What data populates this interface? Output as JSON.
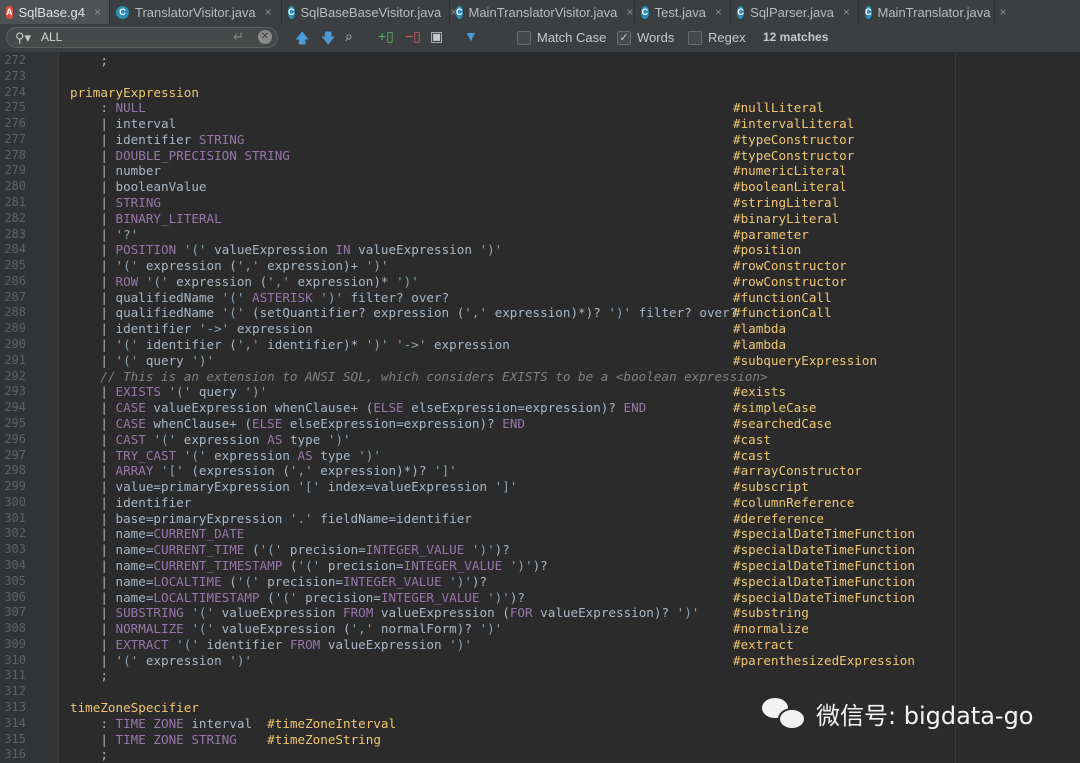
{
  "tabs": [
    {
      "label": "SqlBase.g4",
      "icon": "antlr-file-icon",
      "active": true
    },
    {
      "label": "TranslatorVisitor.java",
      "icon": "java-class-icon",
      "active": false
    },
    {
      "label": "SqlBaseBaseVisitor.java",
      "icon": "java-class-icon",
      "active": false
    },
    {
      "label": "MainTranslatorVisitor.java",
      "icon": "java-class-icon",
      "active": false
    },
    {
      "label": "Test.java",
      "icon": "java-class-icon",
      "active": false
    },
    {
      "label": "SqlParser.java",
      "icon": "java-class-icon",
      "active": false
    },
    {
      "label": "MainTranslator.java",
      "icon": "java-class-icon",
      "active": false
    }
  ],
  "search": {
    "value": "ALL",
    "match_case_label": "Match Case",
    "match_case": false,
    "words_label": "Words",
    "words": true,
    "regex_label": "Regex",
    "regex": false,
    "matches": "12 matches"
  },
  "editor": {
    "lines": [
      {
        "n": "272",
        "code": [
          [
            "    ;",
            "op"
          ]
        ],
        "label": ""
      },
      {
        "n": "273",
        "code": [],
        "label": ""
      },
      {
        "n": "274",
        "code": [
          [
            "primaryExpression",
            "rule"
          ]
        ],
        "label": ""
      },
      {
        "n": "275",
        "code": [
          [
            "    : ",
            "op"
          ],
          [
            "NULL",
            "kw"
          ]
        ],
        "label": "#nullLiteral"
      },
      {
        "n": "276",
        "code": [
          [
            "    | interval",
            "op"
          ]
        ],
        "label": "#intervalLiteral"
      },
      {
        "n": "277",
        "code": [
          [
            "    | identifier ",
            "op"
          ],
          [
            "STRING",
            "kw"
          ]
        ],
        "label": "#typeConstructor"
      },
      {
        "n": "278",
        "code": [
          [
            "    | ",
            "op"
          ],
          [
            "DOUBLE_PRECISION STRING",
            "kw"
          ]
        ],
        "label": "#typeConstructor"
      },
      {
        "n": "279",
        "code": [
          [
            "    | number",
            "op"
          ]
        ],
        "label": "#numericLiteral"
      },
      {
        "n": "280",
        "code": [
          [
            "    | booleanValue",
            "op"
          ]
        ],
        "label": "#booleanLiteral"
      },
      {
        "n": "281",
        "code": [
          [
            "    | ",
            "op"
          ],
          [
            "STRING",
            "kw"
          ]
        ],
        "label": "#stringLiteral"
      },
      {
        "n": "282",
        "code": [
          [
            "    | ",
            "op"
          ],
          [
            "BINARY_LITERAL",
            "kw"
          ]
        ],
        "label": "#binaryLiteral"
      },
      {
        "n": "283",
        "code": [
          [
            "    | ",
            "op"
          ],
          [
            "'?'",
            "str"
          ]
        ],
        "label": "#parameter"
      },
      {
        "n": "284",
        "code": [
          [
            "    | ",
            "op"
          ],
          [
            "POSITION",
            "kw"
          ],
          [
            " ",
            "op"
          ],
          [
            "'('",
            "str"
          ],
          [
            " valueExpression ",
            "op"
          ],
          [
            "IN",
            "kw"
          ],
          [
            " valueExpression ",
            "op"
          ],
          [
            "')'",
            "str"
          ]
        ],
        "label": "#position"
      },
      {
        "n": "285",
        "code": [
          [
            "    | ",
            "op"
          ],
          [
            "'('",
            "str"
          ],
          [
            " expression (",
            "op"
          ],
          [
            "','",
            "str"
          ],
          [
            " expression)+ ",
            "op"
          ],
          [
            "')'",
            "str"
          ]
        ],
        "label": "#rowConstructor"
      },
      {
        "n": "286",
        "code": [
          [
            "    | ",
            "op"
          ],
          [
            "ROW",
            "kw"
          ],
          [
            " ",
            "op"
          ],
          [
            "'('",
            "str"
          ],
          [
            " expression (",
            "op"
          ],
          [
            "','",
            "str"
          ],
          [
            " expression)* ",
            "op"
          ],
          [
            "')'",
            "str"
          ]
        ],
        "label": "#rowConstructor"
      },
      {
        "n": "287",
        "code": [
          [
            "    | qualifiedName ",
            "op"
          ],
          [
            "'('",
            "str"
          ],
          [
            " ",
            "op"
          ],
          [
            "ASTERISK",
            "kw"
          ],
          [
            " ",
            "op"
          ],
          [
            "')'",
            "str"
          ],
          [
            " filter? over?",
            "op"
          ]
        ],
        "label": "#functionCall"
      },
      {
        "n": "288",
        "code": [
          [
            "    | qualifiedName ",
            "op"
          ],
          [
            "'('",
            "str"
          ],
          [
            " (setQuantifier? expression (",
            "op"
          ],
          [
            "','",
            "str"
          ],
          [
            " expression)*)? ",
            "op"
          ],
          [
            "')'",
            "str"
          ],
          [
            " filter? over?",
            "op"
          ]
        ],
        "label": "#functionCall"
      },
      {
        "n": "289",
        "code": [
          [
            "    | identifier ",
            "op"
          ],
          [
            "'->'",
            "str"
          ],
          [
            " expression",
            "op"
          ]
        ],
        "label": "#lambda"
      },
      {
        "n": "290",
        "code": [
          [
            "    | ",
            "op"
          ],
          [
            "'('",
            "str"
          ],
          [
            " identifier (",
            "op"
          ],
          [
            "','",
            "str"
          ],
          [
            " identifier)* ",
            "op"
          ],
          [
            "')'",
            "str"
          ],
          [
            " ",
            "op"
          ],
          [
            "'->'",
            "str"
          ],
          [
            " expression",
            "op"
          ]
        ],
        "label": "#lambda"
      },
      {
        "n": "291",
        "code": [
          [
            "    | ",
            "op"
          ],
          [
            "'('",
            "str"
          ],
          [
            " query ",
            "op"
          ],
          [
            "')'",
            "str"
          ]
        ],
        "label": "#subqueryExpression"
      },
      {
        "n": "292",
        "code": [
          [
            "    // This is an extension to ANSI SQL, which considers EXISTS to be a <boolean expression>",
            "cmt"
          ]
        ],
        "label": ""
      },
      {
        "n": "293",
        "code": [
          [
            "    | ",
            "op"
          ],
          [
            "EXISTS",
            "kw"
          ],
          [
            " ",
            "op"
          ],
          [
            "'('",
            "str"
          ],
          [
            " query ",
            "op"
          ],
          [
            "')'",
            "str"
          ]
        ],
        "label": "#exists"
      },
      {
        "n": "294",
        "code": [
          [
            "    | ",
            "op"
          ],
          [
            "CASE",
            "kw"
          ],
          [
            " valueExpression whenClause+ (",
            "op"
          ],
          [
            "ELSE",
            "kw"
          ],
          [
            " elseExpression=expression)? ",
            "op"
          ],
          [
            "END",
            "kw"
          ]
        ],
        "label": "#simpleCase"
      },
      {
        "n": "295",
        "code": [
          [
            "    | ",
            "op"
          ],
          [
            "CASE",
            "kw"
          ],
          [
            " whenClause+ (",
            "op"
          ],
          [
            "ELSE",
            "kw"
          ],
          [
            " elseExpression=expression)? ",
            "op"
          ],
          [
            "END",
            "kw"
          ]
        ],
        "label": "#searchedCase"
      },
      {
        "n": "296",
        "code": [
          [
            "    | ",
            "op"
          ],
          [
            "CAST",
            "kw"
          ],
          [
            " ",
            "op"
          ],
          [
            "'('",
            "str"
          ],
          [
            " expression ",
            "op"
          ],
          [
            "AS",
            "kw"
          ],
          [
            " type ",
            "op"
          ],
          [
            "')'",
            "str"
          ]
        ],
        "label": "#cast"
      },
      {
        "n": "297",
        "code": [
          [
            "    | ",
            "op"
          ],
          [
            "TRY_CAST",
            "kw"
          ],
          [
            " ",
            "op"
          ],
          [
            "'('",
            "str"
          ],
          [
            " expression ",
            "op"
          ],
          [
            "AS",
            "kw"
          ],
          [
            " type ",
            "op"
          ],
          [
            "')'",
            "str"
          ]
        ],
        "label": "#cast"
      },
      {
        "n": "298",
        "code": [
          [
            "    | ",
            "op"
          ],
          [
            "ARRAY",
            "kw"
          ],
          [
            " ",
            "op"
          ],
          [
            "'['",
            "str"
          ],
          [
            " (expression (",
            "op"
          ],
          [
            "','",
            "str"
          ],
          [
            " expression)*)? ",
            "op"
          ],
          [
            "']'",
            "str"
          ]
        ],
        "label": "#arrayConstructor"
      },
      {
        "n": "299",
        "code": [
          [
            "    | value=primaryExpression ",
            "op"
          ],
          [
            "'['",
            "str"
          ],
          [
            " index=valueExpression ",
            "op"
          ],
          [
            "']'",
            "str"
          ]
        ],
        "label": "#subscript"
      },
      {
        "n": "300",
        "code": [
          [
            "    | identifier",
            "op"
          ]
        ],
        "label": "#columnReference"
      },
      {
        "n": "301",
        "code": [
          [
            "    | base=primaryExpression ",
            "op"
          ],
          [
            "'.'",
            "str"
          ],
          [
            " fieldName=identifier",
            "op"
          ]
        ],
        "label": "#dereference"
      },
      {
        "n": "302",
        "code": [
          [
            "    | name=",
            "op"
          ],
          [
            "CURRENT_DATE",
            "kw"
          ]
        ],
        "label": "#specialDateTimeFunction"
      },
      {
        "n": "303",
        "code": [
          [
            "    | name=",
            "op"
          ],
          [
            "CURRENT_TIME",
            "kw"
          ],
          [
            " (",
            "op"
          ],
          [
            "'('",
            "str"
          ],
          [
            " precision=",
            "op"
          ],
          [
            "INTEGER_VALUE",
            "kw"
          ],
          [
            " ",
            "op"
          ],
          [
            "')'",
            "str"
          ],
          [
            ")?",
            "op"
          ]
        ],
        "label": "#specialDateTimeFunction"
      },
      {
        "n": "304",
        "code": [
          [
            "    | name=",
            "op"
          ],
          [
            "CURRENT_TIMESTAMP",
            "kw"
          ],
          [
            " (",
            "op"
          ],
          [
            "'('",
            "str"
          ],
          [
            " precision=",
            "op"
          ],
          [
            "INTEGER_VALUE",
            "kw"
          ],
          [
            " ",
            "op"
          ],
          [
            "')'",
            "str"
          ],
          [
            ")?",
            "op"
          ]
        ],
        "label": "#specialDateTimeFunction"
      },
      {
        "n": "305",
        "code": [
          [
            "    | name=",
            "op"
          ],
          [
            "LOCALTIME",
            "kw"
          ],
          [
            " (",
            "op"
          ],
          [
            "'('",
            "str"
          ],
          [
            " precision=",
            "op"
          ],
          [
            "INTEGER_VALUE",
            "kw"
          ],
          [
            " ",
            "op"
          ],
          [
            "')'",
            "str"
          ],
          [
            ")?",
            "op"
          ]
        ],
        "label": "#specialDateTimeFunction"
      },
      {
        "n": "306",
        "code": [
          [
            "    | name=",
            "op"
          ],
          [
            "LOCALTIMESTAMP",
            "kw"
          ],
          [
            " (",
            "op"
          ],
          [
            "'('",
            "str"
          ],
          [
            " precision=",
            "op"
          ],
          [
            "INTEGER_VALUE",
            "kw"
          ],
          [
            " ",
            "op"
          ],
          [
            "')'",
            "str"
          ],
          [
            ")?",
            "op"
          ]
        ],
        "label": "#specialDateTimeFunction"
      },
      {
        "n": "307",
        "code": [
          [
            "    | ",
            "op"
          ],
          [
            "SUBSTRING",
            "kw"
          ],
          [
            " ",
            "op"
          ],
          [
            "'('",
            "str"
          ],
          [
            " valueExpression ",
            "op"
          ],
          [
            "FROM",
            "kw"
          ],
          [
            " valueExpression (",
            "op"
          ],
          [
            "FOR",
            "kw"
          ],
          [
            " valueExpression)? ",
            "op"
          ],
          [
            "')'",
            "str"
          ]
        ],
        "label": "#substring"
      },
      {
        "n": "308",
        "code": [
          [
            "    | ",
            "op"
          ],
          [
            "NORMALIZE",
            "kw"
          ],
          [
            " ",
            "op"
          ],
          [
            "'('",
            "str"
          ],
          [
            " valueExpression (",
            "op"
          ],
          [
            "','",
            "str"
          ],
          [
            " normalForm)? ",
            "op"
          ],
          [
            "')'",
            "str"
          ]
        ],
        "label": "#normalize"
      },
      {
        "n": "309",
        "code": [
          [
            "    | ",
            "op"
          ],
          [
            "EXTRACT",
            "kw"
          ],
          [
            " ",
            "op"
          ],
          [
            "'('",
            "str"
          ],
          [
            " identifier ",
            "op"
          ],
          [
            "FROM",
            "kw"
          ],
          [
            " valueExpression ",
            "op"
          ],
          [
            "')'",
            "str"
          ]
        ],
        "label": "#extract"
      },
      {
        "n": "310",
        "code": [
          [
            "    | ",
            "op"
          ],
          [
            "'('",
            "str"
          ],
          [
            " expression ",
            "op"
          ],
          [
            "')'",
            "str"
          ]
        ],
        "label": "#parenthesizedExpression"
      },
      {
        "n": "311",
        "code": [
          [
            "    ;",
            "op"
          ]
        ],
        "label": ""
      },
      {
        "n": "312",
        "code": [],
        "label": ""
      },
      {
        "n": "313",
        "code": [
          [
            "timeZoneSpecifier",
            "rule"
          ]
        ],
        "label": ""
      },
      {
        "n": "314",
        "code": [
          [
            "    : ",
            "op"
          ],
          [
            "TIME ZONE",
            "kw"
          ],
          [
            " interval  ",
            "op"
          ],
          [
            "#timeZoneInterval",
            "lbl"
          ]
        ],
        "label": ""
      },
      {
        "n": "315",
        "code": [
          [
            "    | ",
            "op"
          ],
          [
            "TIME ZONE STRING",
            "kw"
          ],
          [
            "    ",
            "op"
          ],
          [
            "#timeZoneString",
            "lbl"
          ]
        ],
        "label": ""
      },
      {
        "n": "316",
        "code": [
          [
            "    ;",
            "op"
          ]
        ],
        "label": ""
      }
    ]
  },
  "watermark": {
    "text": "微信号: bigdata-go",
    "icon": "wechat-icon"
  },
  "colors": {
    "background": "#2b2b2b",
    "keyword": "#9876aa",
    "label": "#f0c674",
    "string": "#8aa4b5",
    "comment": "#808080",
    "rule": "#f0c674"
  }
}
